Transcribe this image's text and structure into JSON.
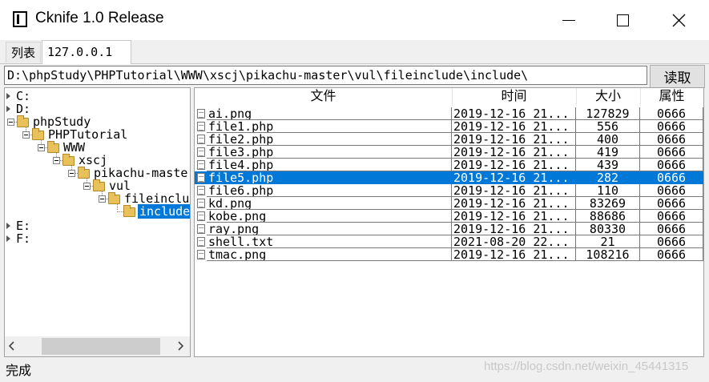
{
  "window": {
    "title": "Cknife 1.0 Release"
  },
  "tabs": [
    {
      "label": "列表"
    },
    {
      "label": "127.0.0.1"
    }
  ],
  "path": {
    "value": "D:\\phpStudy\\PHPTutorial\\WWW\\xscj\\pikachu-master\\vul\\fileinclude\\include\\"
  },
  "read_button": "读取",
  "tree": [
    {
      "label": "C:",
      "depth": 0,
      "kind": "drive"
    },
    {
      "label": "D:",
      "depth": 0,
      "kind": "drive"
    },
    {
      "label": "phpStudy",
      "depth": 0,
      "kind": "folder"
    },
    {
      "label": "PHPTutorial",
      "depth": 1,
      "kind": "folder"
    },
    {
      "label": "WWW",
      "depth": 2,
      "kind": "folder"
    },
    {
      "label": "xscj",
      "depth": 3,
      "kind": "folder"
    },
    {
      "label": "pikachu-master",
      "depth": 4,
      "kind": "folder"
    },
    {
      "label": "vul",
      "depth": 5,
      "kind": "folder"
    },
    {
      "label": "fileinclude",
      "depth": 6,
      "kind": "folder"
    },
    {
      "label": "include",
      "depth": 7,
      "kind": "leaf",
      "selected": true
    },
    {
      "label": "E:",
      "depth": 0,
      "kind": "drive"
    },
    {
      "label": "F:",
      "depth": 0,
      "kind": "drive"
    }
  ],
  "columns": {
    "name": "文件",
    "time": "时间",
    "size": "大小",
    "attr": "属性"
  },
  "files": [
    {
      "name": "ai.png",
      "time": "2019-12-16 21...",
      "size": "127829",
      "attr": "0666"
    },
    {
      "name": "file1.php",
      "time": "2019-12-16 21...",
      "size": "556",
      "attr": "0666"
    },
    {
      "name": "file2.php",
      "time": "2019-12-16 21...",
      "size": "400",
      "attr": "0666"
    },
    {
      "name": "file3.php",
      "time": "2019-12-16 21...",
      "size": "419",
      "attr": "0666"
    },
    {
      "name": "file4.php",
      "time": "2019-12-16 21...",
      "size": "439",
      "attr": "0666"
    },
    {
      "name": "file5.php",
      "time": "2019-12-16 21...",
      "size": "282",
      "attr": "0666",
      "selected": true
    },
    {
      "name": "file6.php",
      "time": "2019-12-16 21...",
      "size": "110",
      "attr": "0666"
    },
    {
      "name": "kd.png",
      "time": "2019-12-16 21...",
      "size": "83269",
      "attr": "0666"
    },
    {
      "name": "kobe.png",
      "time": "2019-12-16 21...",
      "size": "88686",
      "attr": "0666"
    },
    {
      "name": "ray.png",
      "time": "2019-12-16 21...",
      "size": "80330",
      "attr": "0666"
    },
    {
      "name": "shell.txt",
      "time": "2021-08-20 22...",
      "size": "21",
      "attr": "0666"
    },
    {
      "name": "tmac.png",
      "time": "2019-12-16 21...",
      "size": "108216",
      "attr": "0666"
    }
  ],
  "status": "完成",
  "watermark": "https://blog.csdn.net/weixin_45441315",
  "colors": {
    "selection": "#0078d7"
  }
}
